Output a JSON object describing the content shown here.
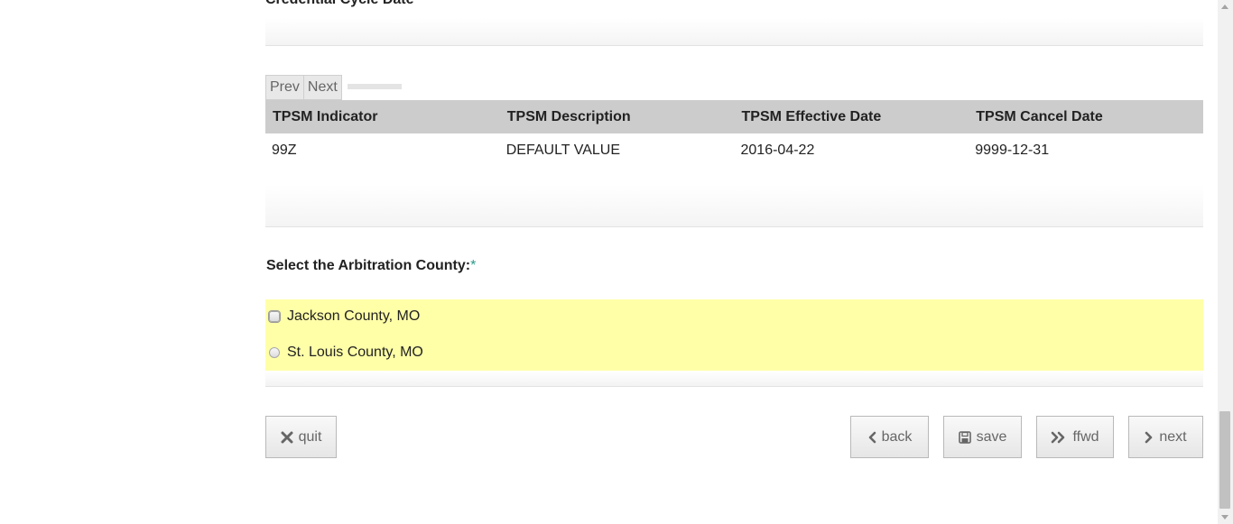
{
  "section_title": "Credential Cycle Date",
  "pager": {
    "prev": "Prev",
    "next": "Next"
  },
  "tpsm_table": {
    "headers": [
      "TPSM Indicator",
      "TPSM Description",
      "TPSM Effective Date",
      "TPSM Cancel Date"
    ],
    "rows": [
      [
        "99Z",
        "DEFAULT VALUE",
        "2016-04-22",
        "9999-12-31"
      ]
    ]
  },
  "arbitration": {
    "label": "Select the Arbitration County:",
    "required_mark": "*",
    "options": [
      "Jackson County, MO",
      "St. Louis County, MO"
    ],
    "highlight_color": "#ffffa8"
  },
  "buttons": {
    "quit": "quit",
    "back": "back",
    "save": "save",
    "ffwd": "ffwd",
    "next": "next"
  },
  "icons": {
    "quit": "close-x-icon",
    "back": "chevron-left-icon",
    "save": "floppy-disk-icon",
    "ffwd": "double-chevron-right-icon",
    "next": "chevron-right-icon"
  }
}
